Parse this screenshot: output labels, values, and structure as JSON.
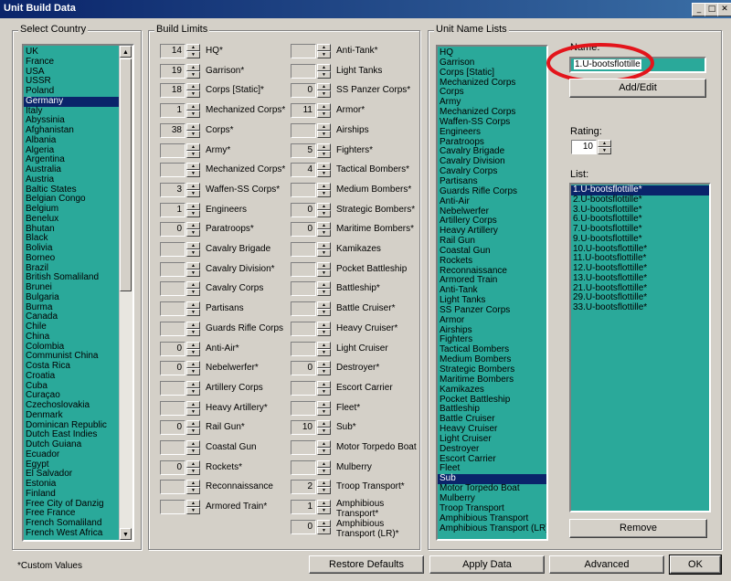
{
  "window": {
    "title": "Unit Build Data",
    "min_icon": "minimize-icon",
    "max_icon": "maximize-icon",
    "close_icon": "close-icon"
  },
  "country_group": {
    "label": "Select Country",
    "items": [
      "UK",
      "France",
      "USA",
      "USSR",
      "Poland",
      "Germany",
      "Italy",
      "Abyssinia",
      "Afghanistan",
      "Albania",
      "Algeria",
      "Argentina",
      "Australia",
      "Austria",
      "Baltic States",
      "Belgian Congo",
      "Belgium",
      "Benelux",
      "Bhutan",
      "Black",
      "Bolivia",
      "Borneo",
      "Brazil",
      "British Somaliland",
      "Brunei",
      "Bulgaria",
      "Burma",
      "Canada",
      "Chile",
      "China",
      "Colombia",
      "Communist China",
      "Costa Rica",
      "Croatia",
      "Cuba",
      "Curaçao",
      "Czechoslovakia",
      "Denmark",
      "Dominican Republic",
      "Dutch East Indies",
      "Dutch Guiana",
      "Ecuador",
      "Egypt",
      "El Salvador",
      "Estonia",
      "Finland",
      "Free City of Danzig",
      "Free France",
      "French Somaliland",
      "French West Africa"
    ],
    "selected": "Germany"
  },
  "build_limits": {
    "label": "Build Limits",
    "col1": [
      {
        "value": "14",
        "label": "HQ*"
      },
      {
        "value": "19",
        "label": "Garrison*"
      },
      {
        "value": "18",
        "label": "Corps [Static]*"
      },
      {
        "value": "1",
        "label": "Mechanized Corps*"
      },
      {
        "value": "38",
        "label": "Corps*"
      },
      {
        "value": "",
        "label": "Army*"
      },
      {
        "value": "",
        "label": "Mechanized Corps*"
      },
      {
        "value": "3",
        "label": "Waffen-SS Corps*"
      },
      {
        "value": "1",
        "label": "Engineers"
      },
      {
        "value": "0",
        "label": "Paratroops*"
      },
      {
        "value": "",
        "label": "Cavalry Brigade"
      },
      {
        "value": "",
        "label": "Cavalry Division*"
      },
      {
        "value": "",
        "label": "Cavalry Corps"
      },
      {
        "value": "",
        "label": "Partisans"
      },
      {
        "value": "",
        "label": "Guards Rifle Corps"
      },
      {
        "value": "0",
        "label": "Anti-Air*"
      },
      {
        "value": "0",
        "label": "Nebelwerfer*"
      },
      {
        "value": "",
        "label": "Artillery Corps"
      },
      {
        "value": "",
        "label": "Heavy Artillery*"
      },
      {
        "value": "0",
        "label": "Rail Gun*"
      },
      {
        "value": "",
        "label": "Coastal Gun"
      },
      {
        "value": "0",
        "label": "Rockets*"
      },
      {
        "value": "",
        "label": "Reconnaissance"
      },
      {
        "value": "",
        "label": "Armored Train*"
      }
    ],
    "col2": [
      {
        "value": "",
        "label": "Anti-Tank*"
      },
      {
        "value": "",
        "label": "Light Tanks"
      },
      {
        "value": "0",
        "label": "SS Panzer Corps*"
      },
      {
        "value": "11",
        "label": "Armor*"
      },
      {
        "value": "",
        "label": "Airships"
      },
      {
        "value": "5",
        "label": "Fighters*"
      },
      {
        "value": "4",
        "label": "Tactical Bombers*"
      },
      {
        "value": "",
        "label": "Medium Bombers*"
      },
      {
        "value": "0",
        "label": "Strategic Bombers*"
      },
      {
        "value": "0",
        "label": "Maritime Bombers*"
      },
      {
        "value": "",
        "label": "Kamikazes"
      },
      {
        "value": "",
        "label": "Pocket Battleship"
      },
      {
        "value": "",
        "label": "Battleship*"
      },
      {
        "value": "",
        "label": "Battle Cruiser*"
      },
      {
        "value": "",
        "label": "Heavy Cruiser*"
      },
      {
        "value": "",
        "label": "Light Cruiser"
      },
      {
        "value": "0",
        "label": "Destroyer*"
      },
      {
        "value": "",
        "label": "Escort Carrier"
      },
      {
        "value": "",
        "label": "Fleet*"
      },
      {
        "value": "10",
        "label": "Sub*"
      },
      {
        "value": "",
        "label": "Motor Torpedo Boat"
      },
      {
        "value": "",
        "label": "Mulberry"
      },
      {
        "value": "2",
        "label": "Troop Transport*"
      },
      {
        "value": "1",
        "label": "Amphibious Transport*"
      },
      {
        "value": "0",
        "label": "Amphibious Transport (LR)*"
      }
    ]
  },
  "unit_names": {
    "label": "Unit Name Lists",
    "items": [
      "HQ",
      "Garrison",
      "Corps [Static]",
      "Mechanized Corps",
      "Corps",
      "Army",
      "Mechanized Corps",
      "Waffen-SS Corps",
      "Engineers",
      "Paratroops",
      "Cavalry Brigade",
      "Cavalry Division",
      "Cavalry Corps",
      "Partisans",
      "Guards Rifle Corps",
      "Anti-Air",
      "Nebelwerfer",
      "Artillery Corps",
      "Heavy Artillery",
      "Rail Gun",
      "Coastal Gun",
      "Rockets",
      "Reconnaissance",
      "Armored Train",
      "Anti-Tank",
      "Light Tanks",
      "SS Panzer Corps",
      "Armor",
      "Airships",
      "Fighters",
      "Tactical Bombers",
      "Medium Bombers",
      "Strategic Bombers",
      "Maritime Bombers",
      "Kamikazes",
      "Pocket Battleship",
      "Battleship",
      "Battle Cruiser",
      "Heavy Cruiser",
      "Light Cruiser",
      "Destroyer",
      "Escort Carrier",
      "Fleet",
      "Sub",
      "Motor Torpedo Boat",
      "Mulberry",
      "Troop Transport",
      "Amphibious Transport",
      "Amphibious Transport (LR)"
    ],
    "selected": "Sub",
    "name_label": "Name:",
    "name_value": "1.U-bootsflottille",
    "add_edit": "Add/Edit",
    "rating_label": "Rating:",
    "rating_value": "10",
    "list_label": "List:",
    "list_items": [
      "1.U-bootsflottille*",
      "2.U-bootsflottille*",
      "3.U-bootsflottille*",
      "6.U-bootsflottille*",
      "7.U-bootsflottille*",
      "9.U-bootsflottille*",
      "10.U-bootsflottille*",
      "11.U-bootsflottille*",
      "12.U-bootsflottille*",
      "13.U-bootsflottille*",
      "21.U-bootsflottille*",
      "29.U-bootsflottille*",
      "33.U-bootsflottille*"
    ],
    "remove": "Remove"
  },
  "footer": {
    "note": "*Custom Values",
    "restore": "Restore Defaults",
    "apply": "Apply Data",
    "advanced": "Advanced",
    "ok": "OK"
  },
  "colors": {
    "list_bg": "#2aa99a",
    "selection": "#0a246a",
    "highlight_ring": "#e3141b"
  }
}
